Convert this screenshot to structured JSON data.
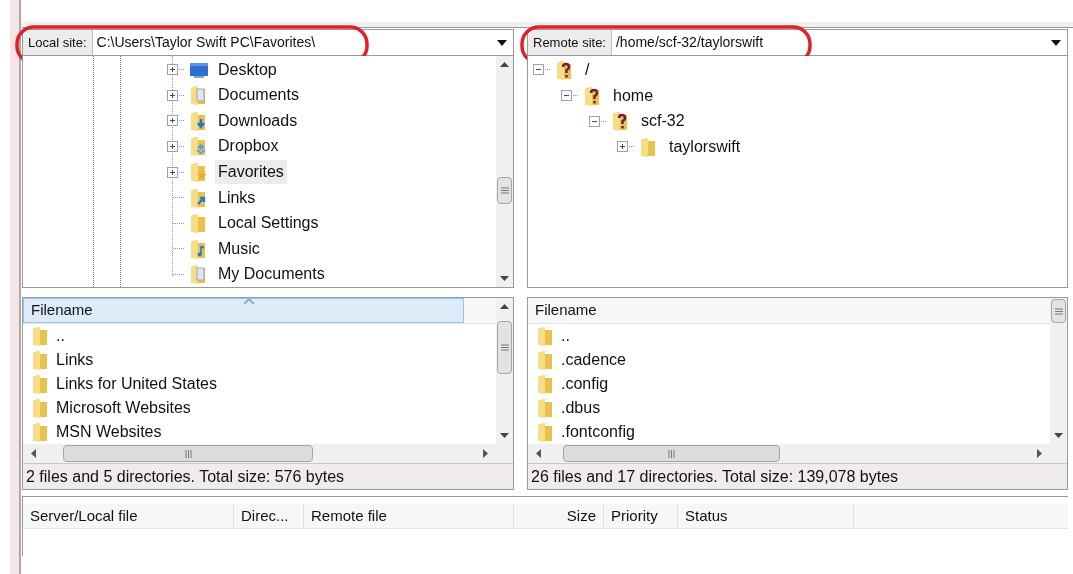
{
  "local_site": {
    "label": "Local site:",
    "value": "C:\\Users\\Taylor Swift PC\\Favorites\\",
    "highlighted": true
  },
  "remote_site": {
    "label": "Remote site:",
    "value": "/home/scf-32/taylorswift",
    "highlighted": true
  },
  "local_tree": {
    "items": [
      {
        "label": "Desktop",
        "kind": "desktop",
        "expandable": true,
        "selected": false
      },
      {
        "label": "Documents",
        "kind": "documents",
        "expandable": true,
        "selected": false
      },
      {
        "label": "Downloads",
        "kind": "downloads",
        "expandable": true,
        "selected": false
      },
      {
        "label": "Dropbox",
        "kind": "dropbox",
        "expandable": true,
        "selected": false
      },
      {
        "label": "Favorites",
        "kind": "favorites",
        "expandable": true,
        "selected": true
      },
      {
        "label": "Links",
        "kind": "links",
        "expandable": false,
        "selected": false
      },
      {
        "label": "Local Settings",
        "kind": "folder",
        "expandable": false,
        "selected": false
      },
      {
        "label": "Music",
        "kind": "music",
        "expandable": false,
        "selected": false
      },
      {
        "label": "My Documents",
        "kind": "documents",
        "expandable": false,
        "selected": false
      }
    ]
  },
  "remote_tree": {
    "items": [
      {
        "label": "/",
        "kind": "unknown",
        "expanded": true,
        "children": [
          {
            "label": "home",
            "kind": "unknown",
            "expanded": true,
            "children": [
              {
                "label": "scf-32",
                "kind": "unknown",
                "expanded": true,
                "children": [
                  {
                    "label": "taylorswift",
                    "kind": "folder",
                    "expanded": false
                  }
                ]
              }
            ]
          }
        ]
      }
    ]
  },
  "local_files": {
    "columns": [
      {
        "label": "Filename",
        "sorted": true
      }
    ],
    "rows": [
      "..",
      "Links",
      "Links for United States",
      "Microsoft Websites",
      "MSN Websites"
    ],
    "status": "2 files and 5 directories. Total size: 576 bytes"
  },
  "remote_files": {
    "columns": [
      {
        "label": "Filename",
        "sorted": false
      }
    ],
    "rows": [
      "..",
      ".cadence",
      ".config",
      ".dbus",
      ".fontconfig"
    ],
    "status": "26 files and 17 directories. Total size: 139,078 bytes"
  },
  "queue": {
    "columns": [
      "Server/Local file",
      "Direc...",
      "Remote file",
      "Size",
      "Priority",
      "Status"
    ]
  }
}
